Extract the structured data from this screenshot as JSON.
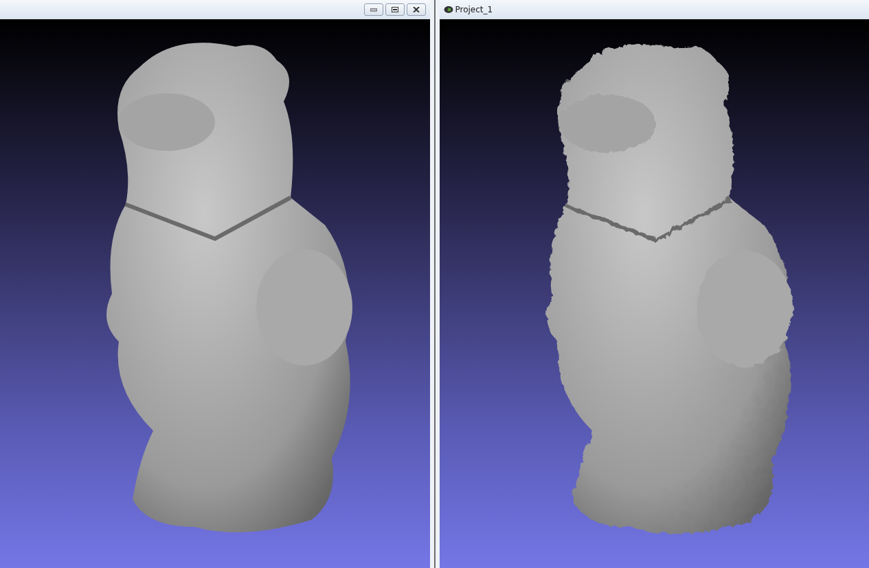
{
  "windows": [
    {
      "kind": "controls"
    },
    {
      "kind": "titled",
      "title": "Project_1"
    }
  ]
}
